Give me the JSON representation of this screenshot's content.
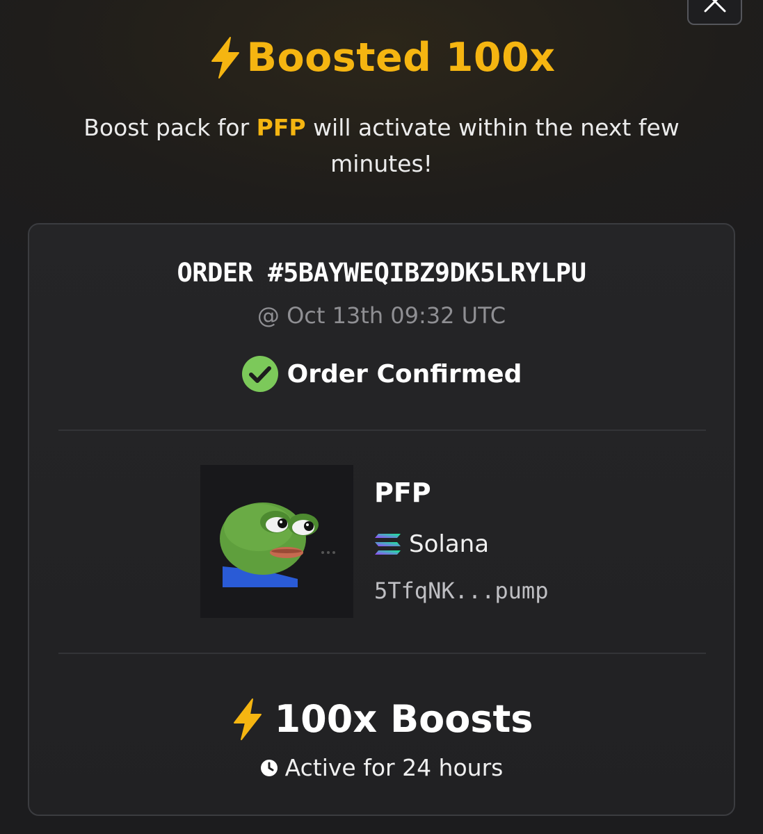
{
  "header": {
    "title": "Boosted 100x",
    "subtitle_prefix": "Boost pack for ",
    "subtitle_token": "PFP",
    "subtitle_suffix": " will activate within the next few minutes!"
  },
  "order": {
    "id": "ORDER #5BAYWEQIBZ9DK5LRYLPU",
    "timestamp": "@ Oct 13th 09:32 UTC",
    "status": "Order Confirmed"
  },
  "token": {
    "name": "PFP",
    "chain": "Solana",
    "address": "5TfqNK...pump"
  },
  "boost": {
    "label": "100x Boosts",
    "duration": "Active for 24 hours"
  },
  "icons": {
    "title": "lightning-icon",
    "status": "check-circle-icon",
    "chain": "solana-icon",
    "duration": "clock-icon",
    "close": "close-icon"
  },
  "colors": {
    "accent": "#f5b511",
    "success": "#7cc95a",
    "card_border": "#3b3c40"
  }
}
